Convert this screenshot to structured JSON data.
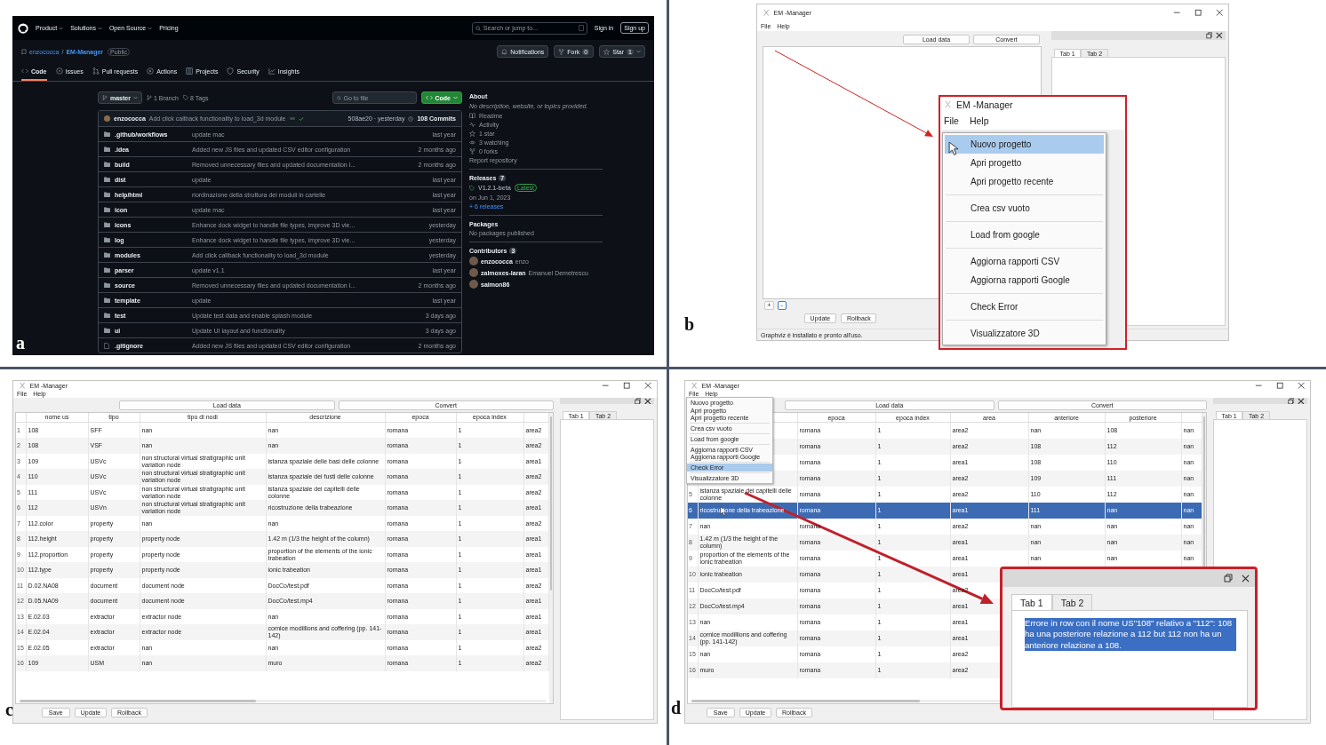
{
  "panel_a": {
    "label": "a",
    "nav": [
      {
        "label": "Product",
        "menu": true
      },
      {
        "label": "Solutions",
        "menu": true
      },
      {
        "label": "Open Source",
        "menu": true
      },
      {
        "label": "Pricing",
        "menu": false
      }
    ],
    "search": {
      "placeholder": "Search or jump to..."
    },
    "sign_in": "Sign in",
    "sign_up": "Sign up",
    "repo": {
      "owner": "enzococca",
      "separator": "/",
      "name": "EM-Manager",
      "visibility": "Public"
    },
    "repo_actions": [
      {
        "kind": "notifications",
        "label": "Notifications"
      },
      {
        "kind": "fork",
        "label": "Fork",
        "count": "0"
      },
      {
        "kind": "star",
        "label": "Star",
        "count": "1"
      }
    ],
    "tabs": [
      {
        "kind": "code",
        "label": "Code",
        "selected": true
      },
      {
        "kind": "issues",
        "label": "Issues",
        "selected": false
      },
      {
        "kind": "pulls",
        "label": "Pull requests",
        "selected": false
      },
      {
        "kind": "actions",
        "label": "Actions",
        "selected": false
      },
      {
        "kind": "projects",
        "label": "Projects",
        "selected": false
      },
      {
        "kind": "security",
        "label": "Security",
        "selected": false
      },
      {
        "kind": "insights",
        "label": "Insights",
        "selected": false
      }
    ],
    "branch": "master",
    "branches": "1 Branch",
    "tags": "8 Tags",
    "go_to_file": {
      "placeholder": "Go to file"
    },
    "code_button": "Code",
    "commit": {
      "author": "enzococca",
      "message": "Add click callback functionality to load_3d module",
      "hash_time": "508ae20 · yesterday",
      "commits": "108 Commits"
    },
    "files": [
      {
        "kind": "folder",
        "name": ".github/workflows",
        "message": "update mac",
        "time": "last year"
      },
      {
        "kind": "folder",
        "name": ".idea",
        "message": "Added new JS files and updated CSV editor configuration",
        "time": "2 months ago"
      },
      {
        "kind": "folder",
        "name": "build",
        "message": "Removed unnecessary files and updated documentation l...",
        "time": "2 months ago"
      },
      {
        "kind": "folder",
        "name": "dist",
        "message": "update",
        "time": "last year"
      },
      {
        "kind": "folder",
        "name": "help/html",
        "message": "riordinazione della struttura dei moduli in cartelle",
        "time": "last year"
      },
      {
        "kind": "folder",
        "name": "icon",
        "message": "update mac",
        "time": "last year"
      },
      {
        "kind": "folder",
        "name": "icons",
        "message": "Enhance dock widget to handle file types, improve 3D vie...",
        "time": "yesterday"
      },
      {
        "kind": "folder",
        "name": "log",
        "message": "Enhance dock widget to handle file types, improve 3D vie...",
        "time": "yesterday"
      },
      {
        "kind": "folder",
        "name": "modules",
        "message": "Add click callback functionality to load_3d module",
        "time": "yesterday"
      },
      {
        "kind": "folder",
        "name": "parser",
        "message": "update v1.1",
        "time": "last year"
      },
      {
        "kind": "folder",
        "name": "source",
        "message": "Removed unnecessary files and updated documentation l...",
        "time": "2 months ago"
      },
      {
        "kind": "folder",
        "name": "template",
        "message": "update",
        "time": "last year"
      },
      {
        "kind": "folder",
        "name": "test",
        "message": "Update test data and enable splash module",
        "time": "3 days ago"
      },
      {
        "kind": "folder",
        "name": "ui",
        "message": "Update UI layout and functionality",
        "time": "3 days ago"
      },
      {
        "kind": "file",
        "name": ".gitignore",
        "message": "Added new JS files and updated CSV editor configuration",
        "time": "2 months ago"
      }
    ],
    "about": {
      "title": "About",
      "description": "No description, website, or topics provided.",
      "items": [
        {
          "kind": "readme",
          "label": "Readme"
        },
        {
          "kind": "activity",
          "label": "Activity"
        },
        {
          "kind": "star",
          "label": "1 star"
        },
        {
          "kind": "watch",
          "label": "3 watching"
        },
        {
          "kind": "fork",
          "label": "0 forks"
        }
      ],
      "report": "Report repository"
    },
    "releases": {
      "title": "Releases",
      "count": "7",
      "latest_name": "V1.2.1-beta",
      "badge": "Latest",
      "date": "on Jun 1, 2023",
      "more": "+ 6 releases"
    },
    "packages": {
      "title": "Packages",
      "text": "No packages published"
    },
    "contributors": {
      "title": "Contributors",
      "count": "3",
      "people": [
        {
          "login": "enzococca",
          "name": "enzo"
        },
        {
          "login": "zalmoxes-laran",
          "name": "Emanuel Demetrescu"
        },
        {
          "login": "saimon86"
        }
      ]
    }
  },
  "panel_b": {
    "label": "b",
    "window": {
      "title": "EM -Manager",
      "menu": [
        "File",
        "Help"
      ],
      "toolbar": [
        "Load data",
        "Convert"
      ],
      "small_buttons": [
        "+",
        "-"
      ],
      "buttons": [
        "Update",
        "Rollback"
      ],
      "tabs": [
        {
          "label": "Tab 1",
          "selected": true
        },
        {
          "label": "Tab 2",
          "selected": false
        }
      ],
      "status": "Graphviz è installato e pronto all'uso."
    },
    "zoom_inset": {
      "title": "EM -Manager",
      "menu": [
        "File",
        "Help"
      ],
      "menu_groups": [
        {
          "items": [
            {
              "label": "Nuovo progetto",
              "selected": true
            },
            {
              "label": "Apri progetto",
              "selected": false
            },
            {
              "label": "Apri progetto recente",
              "selected": false
            }
          ]
        },
        {
          "items": [
            {
              "label": "Crea csv vuoto",
              "selected": false
            }
          ]
        },
        {
          "items": [
            {
              "label": "Load from google",
              "selected": false
            }
          ]
        },
        {
          "items": [
            {
              "label": "Aggiorna rapporti CSV",
              "selected": false
            },
            {
              "label": "Aggiorna rapporti Google",
              "selected": false
            }
          ]
        },
        {
          "items": [
            {
              "label": "Check Error",
              "selected": false
            }
          ]
        },
        {
          "items": [
            {
              "label": "Visualizzatore 3D",
              "selected": false
            }
          ]
        }
      ]
    }
  },
  "panel_c": {
    "label": "c",
    "window": {
      "title": "EM -Manager",
      "menu": [
        "File",
        "Help"
      ],
      "toolbar": [
        "Load data",
        "Convert"
      ],
      "buttons": [
        "Save",
        "Update",
        "Rollback"
      ],
      "tabs": [
        {
          "label": "Tab 1",
          "selected": true
        },
        {
          "label": "Tab 2",
          "selected": false
        }
      ],
      "table": {
        "columns": [
          {
            "kind": "header",
            "label": "nome us"
          },
          {
            "kind": "header",
            "label": "tipo"
          },
          {
            "kind": "header",
            "label": "tipo di nodi"
          },
          {
            "kind": "header",
            "label": "descrizione"
          },
          {
            "kind": "header",
            "label": "epoca"
          },
          {
            "kind": "header",
            "label": "epoca index"
          },
          {
            "kind": "blank"
          }
        ],
        "rows": [
          {
            "num": "1",
            "selected": false,
            "cells": [
              "108",
              "SFF",
              "nan",
              "nan",
              "romana",
              "1",
              "area2"
            ]
          },
          {
            "num": "2",
            "selected": false,
            "cells": [
              "108",
              "VSF",
              "nan",
              "nan",
              "romana",
              "1",
              "area2"
            ]
          },
          {
            "num": "3",
            "selected": false,
            "cells": [
              "109",
              "USVc",
              "non structural virtual stratigraphic unit variation node",
              "istanza spaziale delle basi delle colonne",
              "romana",
              "1",
              "area1"
            ]
          },
          {
            "num": "4",
            "selected": false,
            "cells": [
              "110",
              "USVc",
              "non structural virtual stratigraphic unit variation node",
              "istanza spaziale dei fusti delle colonne",
              "romana",
              "1",
              "area2"
            ]
          },
          {
            "num": "5",
            "selected": false,
            "cells": [
              "111",
              "USVc",
              "non structural virtual stratigraphic unit variation node",
              "istanza spaziale dei capitelli delle colonne",
              "romana",
              "1",
              "area2"
            ]
          },
          {
            "num": "6",
            "selected": false,
            "cells": [
              "112",
              "USVn",
              "non structural virtual stratigraphic unit variation node",
              "ricostruzione della trabeazione",
              "romana",
              "1",
              "area1"
            ]
          },
          {
            "num": "7",
            "selected": false,
            "cells": [
              "112.color",
              "property",
              "nan",
              "nan",
              "romana",
              "1",
              "area2"
            ]
          },
          {
            "num": "8",
            "selected": false,
            "cells": [
              "112.height",
              "property",
              "property node",
              "1.42 m (1/3 the height of the column)",
              "romana",
              "1",
              "area1"
            ]
          },
          {
            "num": "9",
            "selected": false,
            "cells": [
              "112.proportion",
              "property",
              "property node",
              "proportion of the elements of the ionic trabeation",
              "romana",
              "1",
              "area1"
            ]
          },
          {
            "num": "10",
            "selected": false,
            "cells": [
              "112.type",
              "property",
              "property node",
              "ionic trabeation",
              "romana",
              "1",
              "area1"
            ]
          },
          {
            "num": "11",
            "selected": false,
            "cells": [
              "D.02.NA08",
              "document",
              "document node",
              "DocCo/test.pdf",
              "romana",
              "1",
              "area2"
            ]
          },
          {
            "num": "12",
            "selected": false,
            "cells": [
              "D.05.NA09",
              "document",
              "document node",
              "DocCo/test.mp4",
              "romana",
              "1",
              "area1"
            ]
          },
          {
            "num": "13",
            "selected": false,
            "cells": [
              "E.02.03",
              "extractor",
              "extractor node",
              "nan",
              "romana",
              "1",
              "area1"
            ]
          },
          {
            "num": "14",
            "selected": false,
            "cells": [
              "E.02.04",
              "extractor",
              "extractor node",
              "cornice modillions and coffering (pp. 141-142)",
              "romana",
              "1",
              "area1"
            ]
          },
          {
            "num": "15",
            "selected": false,
            "cells": [
              "E.02.05",
              "extractor",
              "nan",
              "nan",
              "romana",
              "1",
              "area2"
            ]
          },
          {
            "num": "16",
            "selected": false,
            "cells": [
              "109",
              "USM",
              "nan",
              "muro",
              "romana",
              "1",
              "area2"
            ]
          }
        ]
      }
    }
  },
  "panel_d": {
    "label": "d",
    "window": {
      "title": "EM -Manager",
      "menu": [
        "File",
        "Help"
      ],
      "toolbar": [
        "Load data",
        "Convert"
      ],
      "buttons": [
        "Save",
        "Update",
        "Rollback"
      ],
      "tabs": [
        {
          "label": "Tab 1",
          "selected": true
        },
        {
          "label": "Tab 2",
          "selected": false
        }
      ],
      "menu_groups": [
        {
          "items": [
            {
              "label": "Nuovo progetto",
              "selected": false
            },
            {
              "label": "Apri progetto",
              "selected": false
            },
            {
              "label": "Apri progetto recente",
              "selected": false
            }
          ]
        },
        {
          "items": [
            {
              "label": "Crea csv vuoto",
              "selected": false
            }
          ]
        },
        {
          "items": [
            {
              "label": "Load from google",
              "selected": false
            }
          ]
        },
        {
          "items": [
            {
              "label": "Aggiorna rapporti CSV",
              "selected": false
            },
            {
              "label": "Aggiorna rapporti Google",
              "selected": false
            }
          ]
        },
        {
          "items": [
            {
              "label": "Check Error",
              "selected": true
            }
          ]
        },
        {
          "items": [
            {
              "label": "Visualizzatore 3D",
              "selected": false
            }
          ]
        }
      ],
      "table": {
        "columns": [
          {
            "kind": "blank"
          },
          {
            "kind": "header",
            "label": "epoca"
          },
          {
            "kind": "header",
            "label": "epoca index"
          },
          {
            "kind": "header",
            "label": "area"
          },
          {
            "kind": "header",
            "label": "anteriore"
          },
          {
            "kind": "header",
            "label": "posteriore"
          },
          {
            "kind": "blank"
          }
        ],
        "rows": [
          {
            "selected": false,
            "cells": [
              null,
              "romana",
              "1",
              "area2",
              "nan",
              "108",
              "nan"
            ]
          },
          {
            "selected": false,
            "cells": [
              null,
              "romana",
              "1",
              "area2",
              "108",
              "112",
              "nan"
            ]
          },
          {
            "selected": false,
            "cells": [
              null,
              "romana",
              "1",
              "area1",
              "108",
              "110",
              "nan"
            ]
          },
          {
            "selected": false,
            "cells": [
              null,
              "romana",
              "1",
              "area2",
              "109",
              "111",
              "nan"
            ]
          },
          {
            "num": "5",
            "selected": false,
            "cells": [
              "istanza spaziale dei capitelli delle colonne",
              "romana",
              "1",
              "area2",
              "110",
              "112",
              "nan"
            ]
          },
          {
            "num": "6",
            "selected": true,
            "cells": [
              "ricostruzione della trabeazione",
              "romana",
              "1",
              "area1",
              "111",
              "nan",
              "nan"
            ]
          },
          {
            "num": "7",
            "selected": false,
            "cells": [
              "nan",
              "romana",
              "1",
              "area2",
              "nan",
              "nan",
              "nan"
            ]
          },
          {
            "num": "8",
            "selected": false,
            "cells": [
              "1.42 m (1/3 the height of the column)",
              "romana",
              "1",
              "area1",
              "nan",
              "nan",
              "nan"
            ]
          },
          {
            "num": "9",
            "selected": false,
            "cells": [
              "proportion of the elements of the ionic trabeation",
              "romana",
              "1",
              "area1",
              "nan",
              "nan",
              "nan"
            ]
          },
          {
            "num": "10",
            "selected": false,
            "cells": [
              "ionic trabeation",
              "romana",
              "1",
              "area1"
            ]
          },
          {
            "num": "11",
            "selected": false,
            "cells": [
              "DocCo/test.pdf",
              "romana",
              "1",
              "area2"
            ]
          },
          {
            "num": "12",
            "selected": false,
            "cells": [
              "DocCo/test.mp4",
              "romana",
              "1",
              "area1"
            ]
          },
          {
            "num": "13",
            "selected": false,
            "cells": [
              "nan",
              "romana",
              "1",
              "area1"
            ]
          },
          {
            "num": "14",
            "selected": false,
            "cells": [
              "cornice modillions and coffering (pp. 141-142)",
              "romana",
              "1",
              "area1"
            ]
          },
          {
            "num": "15",
            "selected": false,
            "cells": [
              "nan",
              "romana",
              "1",
              "area2"
            ]
          },
          {
            "num": "16",
            "selected": false,
            "cells": [
              "muro",
              "romana",
              "1",
              "area2"
            ]
          }
        ]
      }
    },
    "error_dock": {
      "tabs": [
        {
          "label": "Tab 1",
          "selected": true
        },
        {
          "label": "Tab 2",
          "selected": false
        }
      ],
      "text": "Errore in row con il nome US\"108\" relativo a \"112\": 108 ha una posteriore relazione a 112 but 112 non ha un  anteriore relazione a 108.",
      "text_selected": true
    }
  }
}
